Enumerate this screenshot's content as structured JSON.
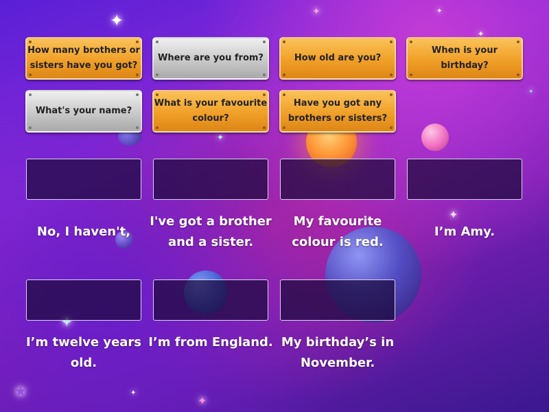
{
  "questions": [
    {
      "text": "How many brothers or sisters have you got?",
      "style": "orange"
    },
    {
      "text": "Where are you from?",
      "style": "grey"
    },
    {
      "text": "How old are you?",
      "style": "orange"
    },
    {
      "text": "When is your birthday?",
      "style": "orange"
    },
    {
      "text": "What's your name?",
      "style": "grey"
    },
    {
      "text": "What is your favourite colour?",
      "style": "orange"
    },
    {
      "text": "Have you got any brothers or sisters?",
      "style": "orange"
    }
  ],
  "answers": [
    "No, I haven't,",
    "I've got a brother and a sister.",
    "My favourite colour is red.",
    "I’m Amy.",
    "I’m twelve years old.",
    "I’m from England.",
    "My birthday’s in November."
  ],
  "colors": {
    "tile_orange": "#f0a028",
    "tile_grey": "#c9c9c9",
    "slot_border": "#d9d2ee",
    "answer_text": "#ffffff"
  }
}
